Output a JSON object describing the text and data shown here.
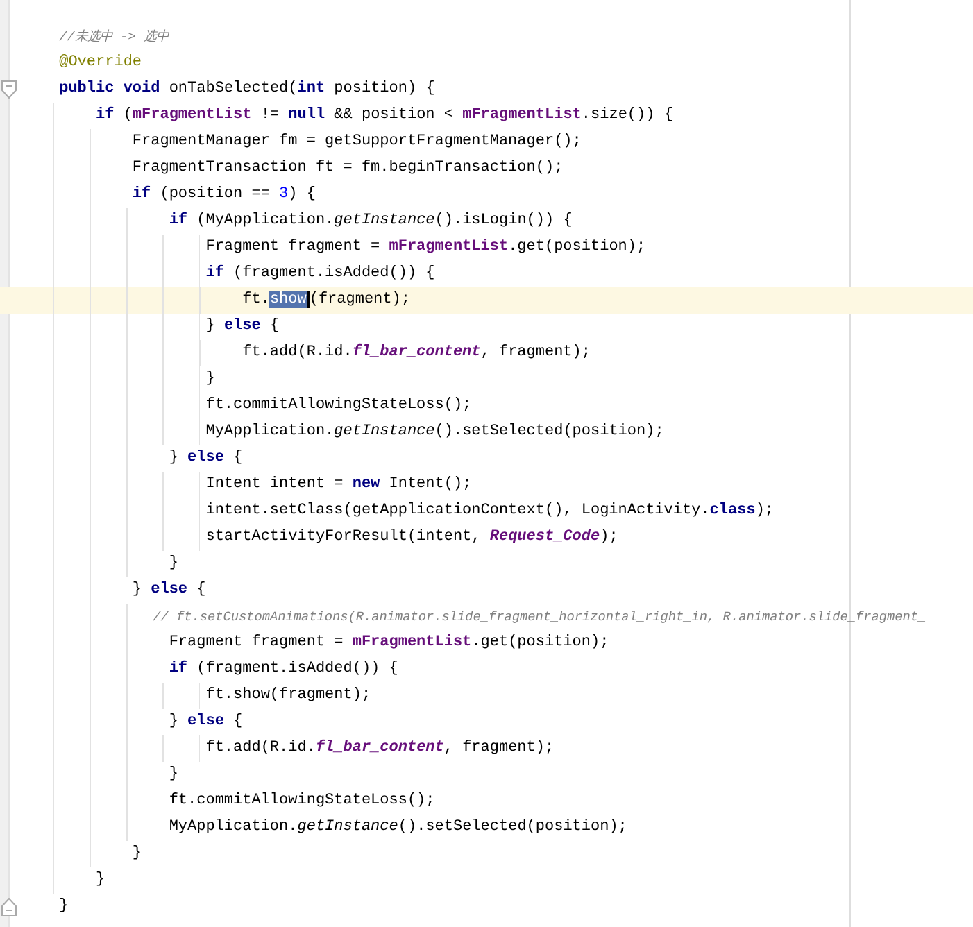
{
  "editor": {
    "lines": [
      {
        "current": false,
        "fold_marker": false,
        "segments": [
          {
            "kind": "comment",
            "text": "//未选中 -> 选中"
          }
        ]
      },
      {
        "current": false,
        "fold_marker": false,
        "segments": [
          {
            "kind": "annotation",
            "text": "@Override"
          }
        ]
      },
      {
        "current": false,
        "fold_marker": true,
        "segments": [
          {
            "kind": "keyword",
            "text": "public void"
          },
          {
            "kind": "plain",
            "text": " onTabSelected("
          },
          {
            "kind": "keyword",
            "text": "int"
          },
          {
            "kind": "plain",
            "text": " position) {"
          }
        ]
      },
      {
        "current": false,
        "fold_marker": false,
        "segments": [
          {
            "kind": "keyword",
            "text": "    if"
          },
          {
            "kind": "plain",
            "text": " ("
          },
          {
            "kind": "field",
            "text": "mFragmentList"
          },
          {
            "kind": "plain",
            "text": " != "
          },
          {
            "kind": "keyword",
            "text": "null"
          },
          {
            "kind": "plain",
            "text": " && position < "
          },
          {
            "kind": "field",
            "text": "mFragmentList"
          },
          {
            "kind": "plain",
            "text": ".size()) {"
          }
        ]
      },
      {
        "current": false,
        "fold_marker": false,
        "segments": [
          {
            "kind": "plain",
            "text": "        FragmentManager fm = getSupportFragmentManager();"
          }
        ]
      },
      {
        "current": false,
        "fold_marker": false,
        "segments": [
          {
            "kind": "plain",
            "text": "        FragmentTransaction ft = fm.beginTransaction();"
          }
        ]
      },
      {
        "current": false,
        "fold_marker": false,
        "segments": [
          {
            "kind": "keyword",
            "text": "        if"
          },
          {
            "kind": "plain",
            "text": " (position == "
          },
          {
            "kind": "number",
            "text": "3"
          },
          {
            "kind": "plain",
            "text": ") {"
          }
        ]
      },
      {
        "current": false,
        "fold_marker": false,
        "segments": [
          {
            "kind": "keyword",
            "text": "            if"
          },
          {
            "kind": "plain",
            "text": " (MyApplication."
          },
          {
            "kind": "static",
            "text": "getInstance"
          },
          {
            "kind": "plain",
            "text": "().isLogin()) {"
          }
        ]
      },
      {
        "current": false,
        "fold_marker": false,
        "segments": [
          {
            "kind": "plain",
            "text": "                Fragment fragment = "
          },
          {
            "kind": "field",
            "text": "mFragmentList"
          },
          {
            "kind": "plain",
            "text": ".get(position);"
          }
        ]
      },
      {
        "current": false,
        "fold_marker": false,
        "segments": [
          {
            "kind": "keyword",
            "text": "                if"
          },
          {
            "kind": "plain",
            "text": " (fragment.isAdded()) {"
          }
        ]
      },
      {
        "current": true,
        "fold_marker": false,
        "segments": [
          {
            "kind": "plain",
            "text": "                    ft."
          },
          {
            "kind": "selection",
            "text": "show"
          },
          {
            "kind": "plain",
            "text": "(fragment);"
          }
        ]
      },
      {
        "current": false,
        "fold_marker": false,
        "segments": [
          {
            "kind": "plain",
            "text": "                } "
          },
          {
            "kind": "keyword",
            "text": "else"
          },
          {
            "kind": "plain",
            "text": " {"
          }
        ]
      },
      {
        "current": false,
        "fold_marker": false,
        "segments": [
          {
            "kind": "plain",
            "text": "                    ft.add(R.id."
          },
          {
            "kind": "constant",
            "text": "fl_bar_content"
          },
          {
            "kind": "plain",
            "text": ", fragment);"
          }
        ]
      },
      {
        "current": false,
        "fold_marker": false,
        "segments": [
          {
            "kind": "plain",
            "text": "                }"
          }
        ]
      },
      {
        "current": false,
        "fold_marker": false,
        "segments": [
          {
            "kind": "plain",
            "text": "                ft.commitAllowingStateLoss();"
          }
        ]
      },
      {
        "current": false,
        "fold_marker": false,
        "segments": [
          {
            "kind": "plain",
            "text": "                MyApplication."
          },
          {
            "kind": "static",
            "text": "getInstance"
          },
          {
            "kind": "plain",
            "text": "().setSelected(position);"
          }
        ]
      },
      {
        "current": false,
        "fold_marker": false,
        "segments": [
          {
            "kind": "plain",
            "text": "            } "
          },
          {
            "kind": "keyword",
            "text": "else"
          },
          {
            "kind": "plain",
            "text": " {"
          }
        ]
      },
      {
        "current": false,
        "fold_marker": false,
        "segments": [
          {
            "kind": "plain",
            "text": "                Intent intent = "
          },
          {
            "kind": "keyword",
            "text": "new"
          },
          {
            "kind": "plain",
            "text": " Intent();"
          }
        ]
      },
      {
        "current": false,
        "fold_marker": false,
        "segments": [
          {
            "kind": "plain",
            "text": "                intent.setClass(getApplicationContext(), LoginActivity."
          },
          {
            "kind": "keyword",
            "text": "class"
          },
          {
            "kind": "plain",
            "text": ");"
          }
        ]
      },
      {
        "current": false,
        "fold_marker": false,
        "segments": [
          {
            "kind": "plain",
            "text": "                startActivityForResult(intent, "
          },
          {
            "kind": "constant",
            "text": "Request_Code"
          },
          {
            "kind": "plain",
            "text": ");"
          }
        ]
      },
      {
        "current": false,
        "fold_marker": false,
        "segments": [
          {
            "kind": "plain",
            "text": "            }"
          }
        ]
      },
      {
        "current": false,
        "fold_marker": false,
        "segments": [
          {
            "kind": "plain",
            "text": "        } "
          },
          {
            "kind": "keyword",
            "text": "else"
          },
          {
            "kind": "plain",
            "text": " {"
          }
        ]
      },
      {
        "current": false,
        "fold_marker": false,
        "segments": [
          {
            "kind": "comment",
            "text": "            // ft.setCustomAnimations(R.animator.slide_fragment_horizontal_right_in, R.animator.slide_fragment_"
          }
        ]
      },
      {
        "current": false,
        "fold_marker": false,
        "segments": [
          {
            "kind": "plain",
            "text": "            Fragment fragment = "
          },
          {
            "kind": "field",
            "text": "mFragmentList"
          },
          {
            "kind": "plain",
            "text": ".get(position);"
          }
        ]
      },
      {
        "current": false,
        "fold_marker": false,
        "segments": [
          {
            "kind": "keyword",
            "text": "            if"
          },
          {
            "kind": "plain",
            "text": " (fragment.isAdded()) {"
          }
        ]
      },
      {
        "current": false,
        "fold_marker": false,
        "segments": [
          {
            "kind": "plain",
            "text": "                ft.show(fragment);"
          }
        ]
      },
      {
        "current": false,
        "fold_marker": false,
        "segments": [
          {
            "kind": "plain",
            "text": "            } "
          },
          {
            "kind": "keyword",
            "text": "else"
          },
          {
            "kind": "plain",
            "text": " {"
          }
        ]
      },
      {
        "current": false,
        "fold_marker": false,
        "segments": [
          {
            "kind": "plain",
            "text": "                ft.add(R.id."
          },
          {
            "kind": "constant",
            "text": "fl_bar_content"
          },
          {
            "kind": "plain",
            "text": ", fragment);"
          }
        ]
      },
      {
        "current": false,
        "fold_marker": false,
        "segments": [
          {
            "kind": "plain",
            "text": "            }"
          }
        ]
      },
      {
        "current": false,
        "fold_marker": false,
        "segments": [
          {
            "kind": "plain",
            "text": "            ft.commitAllowingStateLoss();"
          }
        ]
      },
      {
        "current": false,
        "fold_marker": false,
        "segments": [
          {
            "kind": "plain",
            "text": "            MyApplication."
          },
          {
            "kind": "static",
            "text": "getInstance"
          },
          {
            "kind": "plain",
            "text": "().setSelected(position);"
          }
        ]
      },
      {
        "current": false,
        "fold_marker": false,
        "segments": [
          {
            "kind": "plain",
            "text": "        }"
          }
        ]
      },
      {
        "current": false,
        "fold_marker": false,
        "segments": [
          {
            "kind": "plain",
            "text": "    }"
          }
        ]
      },
      {
        "current": false,
        "fold_marker": true,
        "segments": [
          {
            "kind": "plain",
            "text": "}"
          }
        ]
      }
    ]
  }
}
